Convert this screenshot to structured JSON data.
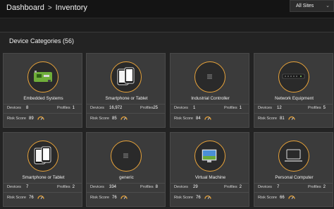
{
  "header": {
    "breadcrumb": {
      "root": "Dashboard",
      "separator": ">",
      "current": "Inventory"
    },
    "site_selector": {
      "value": "All Sites",
      "icon": "chevron-down-icon"
    }
  },
  "section": {
    "title": "Device Categories (56)"
  },
  "labels": {
    "devices": "Devices",
    "profiles": "Profiles",
    "risk_score": "Risk Score"
  },
  "colors": {
    "accent": "#e8a33a",
    "card": "#3b3b3b",
    "background": "#232323"
  },
  "cards": [
    {
      "name": "Embedded Systems",
      "devices": "8",
      "profiles": "1",
      "risk": "89",
      "icon": "circuit-board-icon"
    },
    {
      "name": "Smartphone or Tablet",
      "devices": "16,972",
      "profiles": "25",
      "risk": "85",
      "icon": "smartphone-tablet-icon"
    },
    {
      "name": "Industrial Controller",
      "devices": "1",
      "profiles": "1",
      "risk": "84",
      "icon": "generic-device-icon"
    },
    {
      "name": "Network Equipment",
      "devices": "12",
      "profiles": "5",
      "risk": "81",
      "icon": "network-switch-icon"
    },
    {
      "name": "Smartphone or Tablet",
      "devices": "7",
      "profiles": "2",
      "risk": "76",
      "icon": "smartphone-tablet-icon"
    },
    {
      "name": "generic",
      "devices": "334",
      "profiles": "8",
      "risk": "76",
      "icon": "generic-device-icon"
    },
    {
      "name": "Virtual Machine",
      "devices": "29",
      "profiles": "2",
      "risk": "76",
      "icon": "virtual-machine-icon"
    },
    {
      "name": "Personal Computer",
      "devices": "7",
      "profiles": "2",
      "risk": "66",
      "icon": "laptop-icon"
    }
  ]
}
